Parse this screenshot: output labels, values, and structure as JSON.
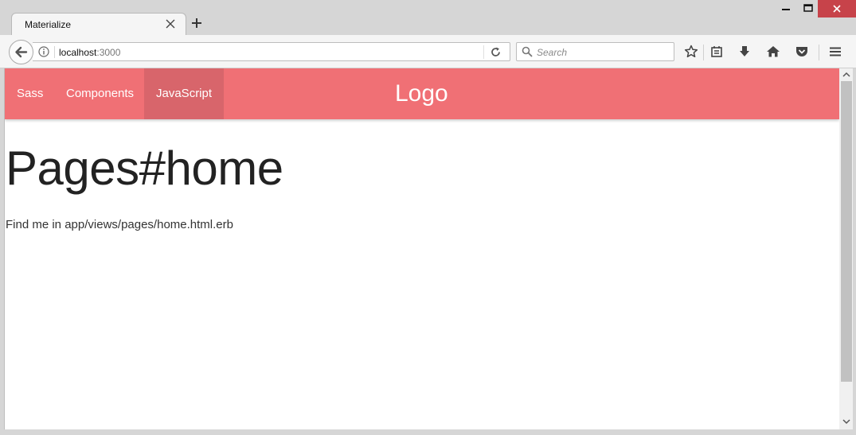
{
  "browser": {
    "tab_title": "Materialize",
    "url_host": "localhost",
    "url_port": ":3000",
    "search_placeholder": "Search",
    "accent_close": "#c7434a"
  },
  "navbar": {
    "color": "#f07075",
    "items": [
      {
        "label": "Sass",
        "active": false
      },
      {
        "label": "Components",
        "active": false
      },
      {
        "label": "JavaScript",
        "active": true
      }
    ],
    "brand": "Logo"
  },
  "page": {
    "title": "Pages#home",
    "text": "Find me in app/views/pages/home.html.erb"
  },
  "toolbar_icons": [
    "star-icon",
    "reading-list-icon",
    "download-icon",
    "home-icon",
    "pocket-icon",
    "menu-icon"
  ]
}
